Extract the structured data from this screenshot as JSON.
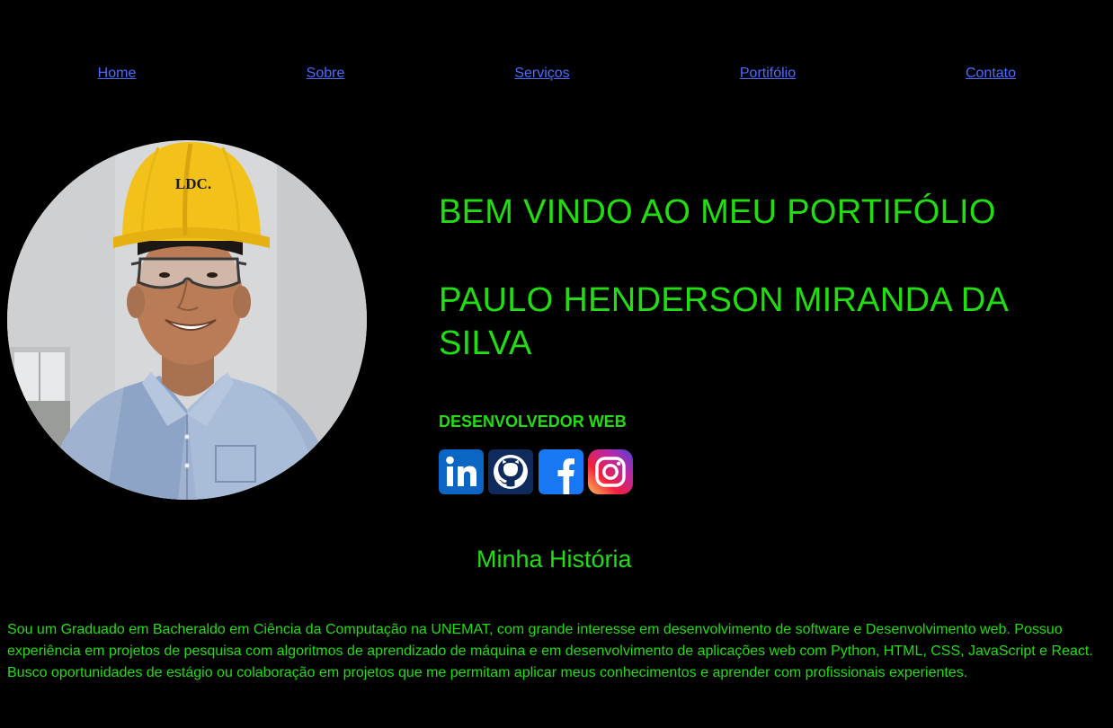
{
  "nav": {
    "items": [
      {
        "label": "Home"
      },
      {
        "label": "Sobre"
      },
      {
        "label": "Serviços"
      },
      {
        "label": "Portifólio"
      },
      {
        "label": "Contato"
      }
    ]
  },
  "hero": {
    "title": "BEM VINDO AO MEU PORTIFÓLIO",
    "name": "PAULO HENDERSON MIRANDA DA SILVA",
    "role": "DESENVOLVEDOR WEB",
    "helmet_text": "LDC."
  },
  "social": {
    "icons": [
      "linkedin-icon",
      "github-icon",
      "facebook-icon",
      "instagram-icon"
    ]
  },
  "history": {
    "title": "Minha História",
    "text": "Sou um Graduado em Bacheraldo em Ciência da Computação na UNEMAT, com grande interesse em desenvolvimento de software e Desenvolvimento web. Possuo experiência em projetos de pesquisa com algoritmos de aprendizado de máquina e em desenvolvimento de aplicações web com Python, HTML, CSS, JavaScript e React. Busco oportunidades de estágio ou colaboração em projetos que me permitam aplicar meus conhecimentos e aprender com profissionais experientes."
  },
  "colors": {
    "background": "#000000",
    "accent": "#22dd11",
    "link": "#4a6cff"
  }
}
